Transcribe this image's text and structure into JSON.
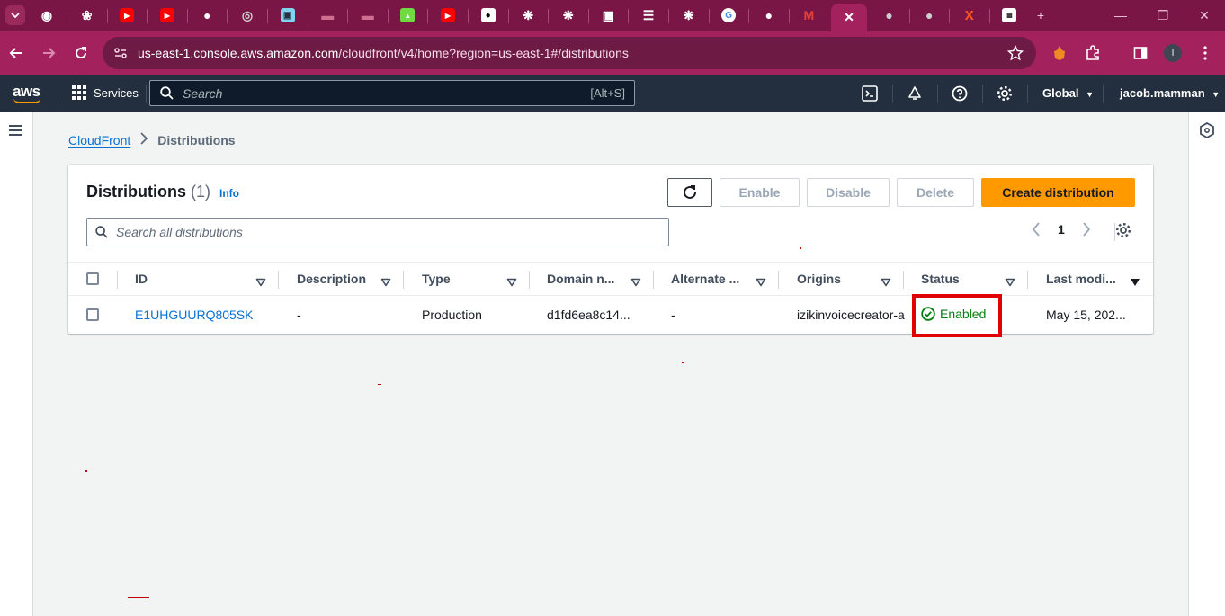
{
  "browser": {
    "tabs": [
      {
        "icon": "chrome-icon",
        "color": "#ffffff"
      },
      {
        "icon": "bug-icon",
        "color": "#ffffff"
      },
      {
        "icon": "youtube-icon",
        "color": "#ff0000"
      },
      {
        "icon": "youtube-icon",
        "color": "#ff0000"
      },
      {
        "icon": "github-icon",
        "color": "#ffffff"
      },
      {
        "icon": "record-icon",
        "color": "#cfcfcf"
      },
      {
        "icon": "doc-icon",
        "color": "#7fd3f0"
      },
      {
        "icon": "folder-icon",
        "color": "#d07090"
      },
      {
        "icon": "folder-icon",
        "color": "#d07090"
      },
      {
        "icon": "upwork-icon",
        "color": "#6fda44"
      },
      {
        "icon": "youtube-icon",
        "color": "#ff0000"
      },
      {
        "icon": "medium-icon",
        "color": "#000000"
      },
      {
        "icon": "openai-icon",
        "color": "#ffffff"
      },
      {
        "icon": "openai-icon",
        "color": "#ffffff"
      },
      {
        "icon": "bot-icon",
        "color": "#ffffff"
      },
      {
        "icon": "layers-icon",
        "color": "#ffffff"
      },
      {
        "icon": "chatgpt-icon",
        "color": "#ffffff"
      },
      {
        "icon": "google-icon",
        "color": "#ffffff"
      },
      {
        "icon": "github-icon",
        "color": "#ffffff"
      },
      {
        "icon": "gmail-icon",
        "color": "#ffffff"
      },
      {
        "icon": "close-icon",
        "color": "#ffffff",
        "active": true
      },
      {
        "icon": "globe-icon",
        "color": "#cfcfcf"
      },
      {
        "icon": "globe-icon",
        "color": "#cfcfcf"
      },
      {
        "icon": "x-icon",
        "color": "#ff5a1f"
      },
      {
        "icon": "soft-icon",
        "color": "#ffffff"
      }
    ],
    "url_host": "us-east-1.console.aws.amazon.com",
    "url_path": "/cloudfront/v4/home?region=us-east-1#/distributions",
    "profile_initial": "I"
  },
  "aws_nav": {
    "logo": "aws",
    "services_label": "Services",
    "search_placeholder": "Search",
    "search_shortcut": "[Alt+S]",
    "region": "Global",
    "account": "jacob.mamman"
  },
  "breadcrumb": {
    "root": "CloudFront",
    "current": "Distributions"
  },
  "panel": {
    "title": "Distributions",
    "count": "(1)",
    "info": "Info",
    "buttons": {
      "enable": "Enable",
      "disable": "Disable",
      "delete": "Delete",
      "create": "Create distribution"
    },
    "search_placeholder": "Search all distributions",
    "page": "1"
  },
  "table": {
    "columns": [
      "ID",
      "Description",
      "Type",
      "Domain n...",
      "Alternate ...",
      "Origins",
      "Status",
      "Last modi..."
    ],
    "rows": [
      {
        "id": "E1UHGUURQ805SK",
        "description": "-",
        "type": "Production",
        "domain": "d1fd6ea8c14...",
        "alternate": "-",
        "origins": "izikinvoicecreator-a",
        "status": "Enabled",
        "last_modified": "May 15, 202..."
      }
    ]
  },
  "colors": {
    "browser_frame": "#7a1646",
    "aws_nav": "#232f3e",
    "primary_button": "#ff9900",
    "link": "#0972d3",
    "status_ok": "#037f0c",
    "highlight_box": "#e00000"
  }
}
